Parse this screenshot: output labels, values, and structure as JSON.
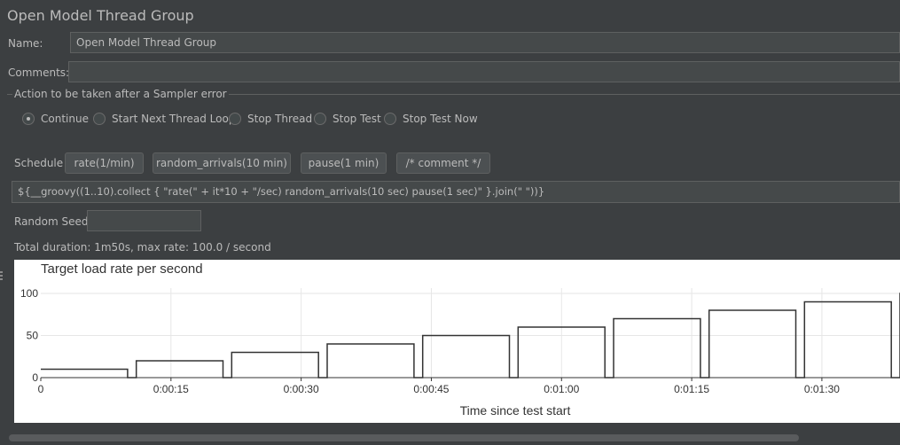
{
  "window": {
    "title": "Open Model Thread Group"
  },
  "name_field": {
    "label": "Name:",
    "value": "Open Model Thread Group"
  },
  "comments_field": {
    "label": "Comments:",
    "value": ""
  },
  "sampler_error": {
    "title": "Action to be taken after a Sampler error",
    "options": [
      {
        "label": "Continue",
        "selected": true
      },
      {
        "label": "Start Next Thread Loop",
        "selected": false
      },
      {
        "label": "Stop Thread",
        "selected": false
      },
      {
        "label": "Stop Test",
        "selected": false
      },
      {
        "label": "Stop Test Now",
        "selected": false
      }
    ]
  },
  "schedule": {
    "label": "Schedule",
    "buttons": [
      "rate(1/min)",
      "random_arrivals(10 min)",
      "pause(1 min)",
      "/* comment */"
    ],
    "expression": "${__groovy((1..10).collect { \"rate(\" + it*10 + \"/sec) random_arrivals(10 sec) pause(1 sec)\" }.join(\" \"))}"
  },
  "random_seed": {
    "label": "Random Seed",
    "value": ""
  },
  "summary": "Total duration: 1m50s, max rate: 100.0 / second",
  "colors": {
    "background": "#3c3f41",
    "field_bg": "#45494a",
    "text": "#bbbbbb",
    "chart_line": "#333333"
  },
  "chart_data": {
    "type": "line",
    "title": "Target load rate per second",
    "xlabel": "Time since test start",
    "ylabel": "",
    "x_ticks": [
      {
        "v": 0,
        "label": "0"
      },
      {
        "v": 15,
        "label": "0:00:15"
      },
      {
        "v": 30,
        "label": "0:00:30"
      },
      {
        "v": 45,
        "label": "0:00:45"
      },
      {
        "v": 60,
        "label": "0:01:00"
      },
      {
        "v": 75,
        "label": "0:01:15"
      },
      {
        "v": 90,
        "label": "0:01:30"
      }
    ],
    "y_ticks": [
      {
        "v": 0,
        "label": "0"
      },
      {
        "v": 50,
        "label": "50"
      },
      {
        "v": 100,
        "label": "100"
      }
    ],
    "xlim": [
      0,
      99
    ],
    "ylim": [
      0,
      100
    ],
    "grid": true,
    "series": [
      {
        "steps": [
          {
            "start": 0,
            "end": 10,
            "rate": 10
          },
          {
            "start": 10,
            "end": 11,
            "rate": 0
          },
          {
            "start": 11,
            "end": 21,
            "rate": 20
          },
          {
            "start": 21,
            "end": 22,
            "rate": 0
          },
          {
            "start": 22,
            "end": 32,
            "rate": 30
          },
          {
            "start": 32,
            "end": 33,
            "rate": 0
          },
          {
            "start": 33,
            "end": 43,
            "rate": 40
          },
          {
            "start": 43,
            "end": 44,
            "rate": 0
          },
          {
            "start": 44,
            "end": 54,
            "rate": 50
          },
          {
            "start": 54,
            "end": 55,
            "rate": 0
          },
          {
            "start": 55,
            "end": 65,
            "rate": 60
          },
          {
            "start": 65,
            "end": 66,
            "rate": 0
          },
          {
            "start": 66,
            "end": 76,
            "rate": 70
          },
          {
            "start": 76,
            "end": 77,
            "rate": 0
          },
          {
            "start": 77,
            "end": 87,
            "rate": 80
          },
          {
            "start": 87,
            "end": 88,
            "rate": 0
          },
          {
            "start": 88,
            "end": 98,
            "rate": 90
          },
          {
            "start": 98,
            "end": 99,
            "rate": 0
          },
          {
            "start": 99,
            "end": 109,
            "rate": 100
          }
        ]
      }
    ]
  }
}
